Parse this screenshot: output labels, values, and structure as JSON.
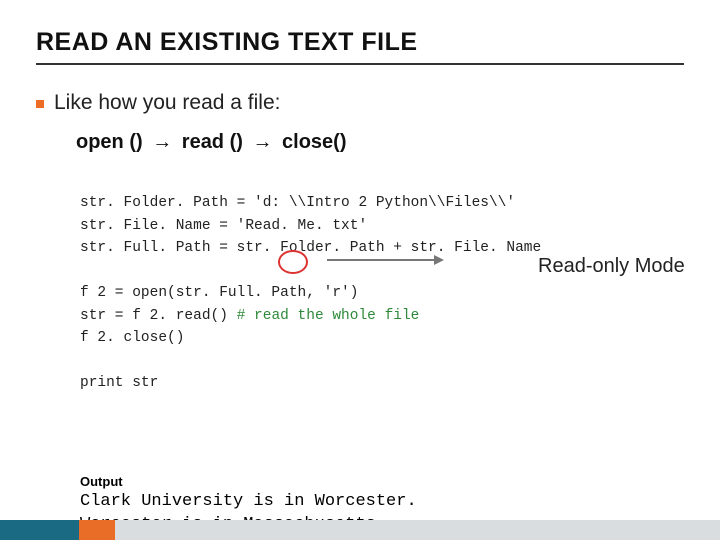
{
  "title": "READ AN EXISTING TEXT FILE",
  "bullet": "Like how you read a file:",
  "flow": {
    "a": "open ()",
    "b": "read ()",
    "c": "close()",
    "arrow": "→"
  },
  "code": {
    "l1": "str. Folder. Path = 'd: \\\\Intro 2 Python\\\\Files\\\\'",
    "l2": "str. File. Name = 'Read. Me. txt'",
    "l3": "str. Full. Path = str. Folder. Path + str. File. Name",
    "blank1": " ",
    "l4a": "f 2 = open(str. Full. Path, ",
    "l4b": "'r'",
    "l4c": ")",
    "l5a": "str = f 2. read() ",
    "l5b": "# read the whole file",
    "l6": "f 2. close()",
    "blank2": " ",
    "l7": "print str"
  },
  "annotation": "Read-only Mode",
  "output": {
    "label": "Output",
    "line1": "Clark University is in Worcester.",
    "line2": "Worcester is in Massachusetts."
  },
  "colors": {
    "accent": "#e96d26",
    "footer_teal": "#1a6a84",
    "circle": "#d33"
  }
}
